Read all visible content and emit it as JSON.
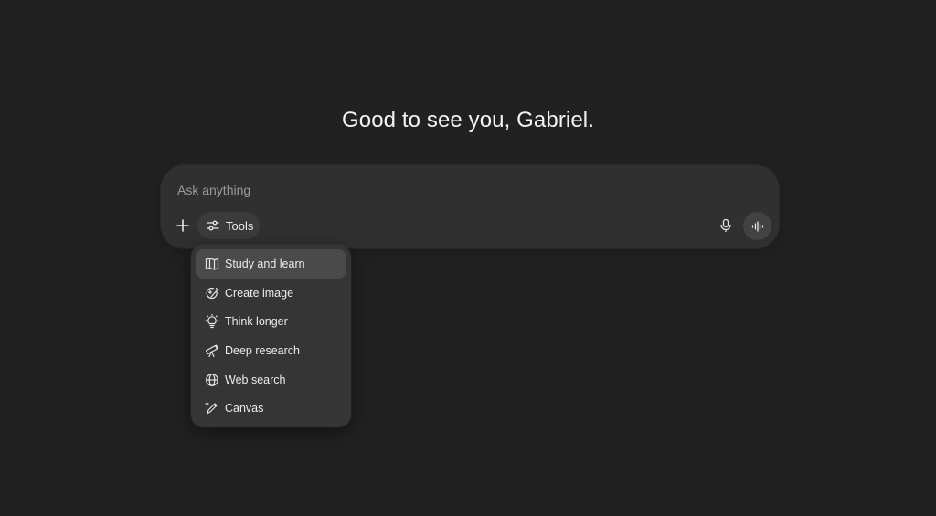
{
  "greeting": "Good to see you, Gabriel.",
  "composer": {
    "placeholder": "Ask anything",
    "value": "",
    "tools_label": "Tools"
  },
  "tools_menu": {
    "items": [
      {
        "label": "Study and learn",
        "icon": "book-icon",
        "active": true
      },
      {
        "label": "Create image",
        "icon": "image-brush-icon",
        "active": false
      },
      {
        "label": "Think longer",
        "icon": "lightbulb-icon",
        "active": false
      },
      {
        "label": "Deep research",
        "icon": "telescope-icon",
        "active": false
      },
      {
        "label": "Web search",
        "icon": "globe-icon",
        "active": false
      },
      {
        "label": "Canvas",
        "icon": "pen-sparkle-icon",
        "active": false
      }
    ]
  },
  "colors": {
    "background": "#212121",
    "composer": "#303030",
    "menu": "#353535",
    "menu_active": "#4a4a4a",
    "text": "#ececec",
    "placeholder": "#9a9a9a"
  }
}
